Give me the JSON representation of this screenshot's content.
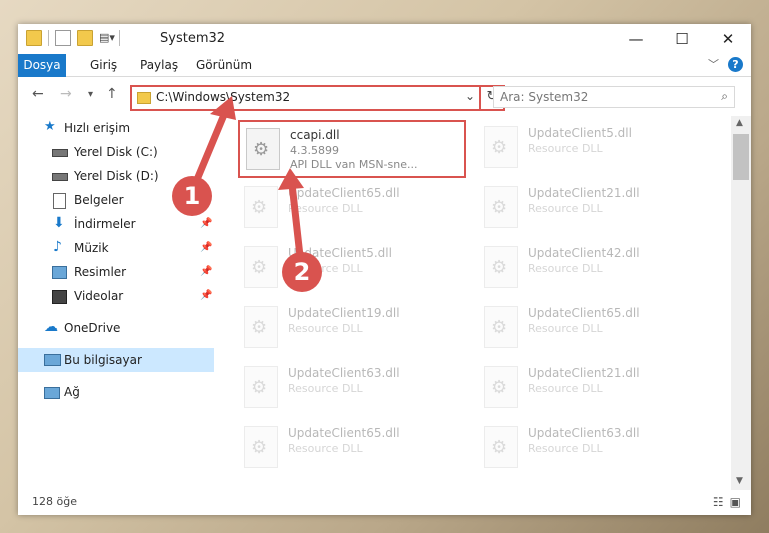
{
  "window": {
    "title": "System32",
    "controls": {
      "minimize": "—",
      "maximize": "☐",
      "close": "✕"
    }
  },
  "ribbon": {
    "tabs": [
      {
        "label": "Dosya",
        "active": true
      },
      {
        "label": "Giriş"
      },
      {
        "label": "Paylaş"
      },
      {
        "label": "Görünüm"
      }
    ],
    "help": "?"
  },
  "navigation": {
    "back": "←",
    "forward": "→",
    "recent": "▾",
    "up": "↑",
    "address": "C:\\Windows\\System32",
    "search_placeholder": "Ara: System32"
  },
  "sidebar": {
    "items": [
      {
        "label": "Hızlı erişim",
        "icon": "star-icon",
        "indent": 0
      },
      {
        "label": "Yerel Disk (C:)",
        "icon": "drive-icon",
        "indent": 1
      },
      {
        "label": "Yerel Disk (D:)",
        "icon": "drive-icon",
        "indent": 1
      },
      {
        "label": "Belgeler",
        "icon": "documents-icon",
        "indent": 1
      },
      {
        "label": "İndirmeler",
        "icon": "download-icon",
        "indent": 1,
        "pinned": true
      },
      {
        "label": "Müzik",
        "icon": "music-icon",
        "indent": 1,
        "pinned": true
      },
      {
        "label": "Resimler",
        "icon": "pictures-icon",
        "indent": 1,
        "pinned": true
      },
      {
        "label": "Videolar",
        "icon": "video-icon",
        "indent": 1,
        "pinned": true
      },
      {
        "label": "OneDrive",
        "icon": "cloud-icon",
        "indent": 0
      },
      {
        "label": "Bu bilgisayar",
        "icon": "computer-icon",
        "indent": 0,
        "selected": true
      },
      {
        "label": "Ağ",
        "icon": "network-icon",
        "indent": 0
      }
    ]
  },
  "files": {
    "main": {
      "name": "ccapi.dll",
      "version": "4.3.5899",
      "description": "API DLL van MSN-sne..."
    },
    "left_column": [
      {
        "name": "UpdateClient65.dll",
        "description": "Resource DLL"
      },
      {
        "name": "UpdateClient5.dll",
        "description": "Resource DLL"
      },
      {
        "name": "UpdateClient19.dll",
        "description": "Resource DLL"
      },
      {
        "name": "UpdateClient63.dll",
        "description": "Resource DLL"
      },
      {
        "name": "UpdateClient65.dll",
        "description": "Resource DLL"
      }
    ],
    "right_column": [
      {
        "name": "UpdateClient5.dll",
        "description": "Resource DLL"
      },
      {
        "name": "UpdateClient21.dll",
        "description": "Resource DLL"
      },
      {
        "name": "UpdateClient42.dll",
        "description": "Resource DLL"
      },
      {
        "name": "UpdateClient65.dll",
        "description": "Resource DLL"
      },
      {
        "name": "UpdateClient21.dll",
        "description": "Resource DLL"
      },
      {
        "name": "UpdateClient63.dll",
        "description": "Resource DLL"
      }
    ]
  },
  "status": {
    "count": "128 öğe"
  },
  "annotations": [
    {
      "label": "1"
    },
    {
      "label": "2"
    }
  ],
  "colors": {
    "accent": "#1979ca",
    "highlight": "#d9534f",
    "selected": "#cce8ff"
  }
}
